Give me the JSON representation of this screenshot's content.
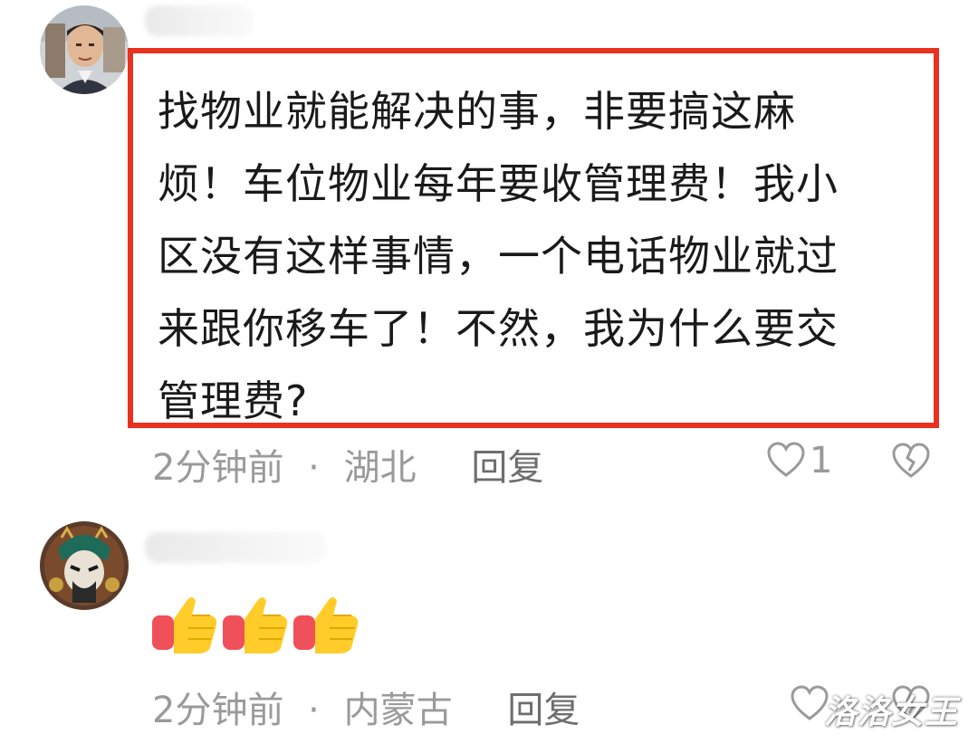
{
  "comments": [
    {
      "text_lines": [
        "找物业就能解决的事，非要搞这麻",
        "烦！车位物业每年要收管理费！我小",
        "区没有这样事情，一个电话物业就过",
        "来跟你移车了！不然，我为什么要交",
        "管理费?"
      ],
      "time": "2分钟前",
      "separator": "·",
      "location": "湖北",
      "reply_label": "回复",
      "like_count": "1",
      "like_icon": "heart-outline-icon",
      "dislike_icon": "broken-heart-icon"
    },
    {
      "emoji": "thumbs-up-icon",
      "time": "2分钟前",
      "separator": "·",
      "location": "内蒙古",
      "reply_label": "回复",
      "like_icon": "heart-outline-icon",
      "dislike_icon": "broken-heart-icon"
    }
  ],
  "watermark": "洛洛女王",
  "colors": {
    "highlight_border": "#e8321f",
    "meta_text": "#9a9a9a",
    "body_text": "#1a1a1a"
  }
}
